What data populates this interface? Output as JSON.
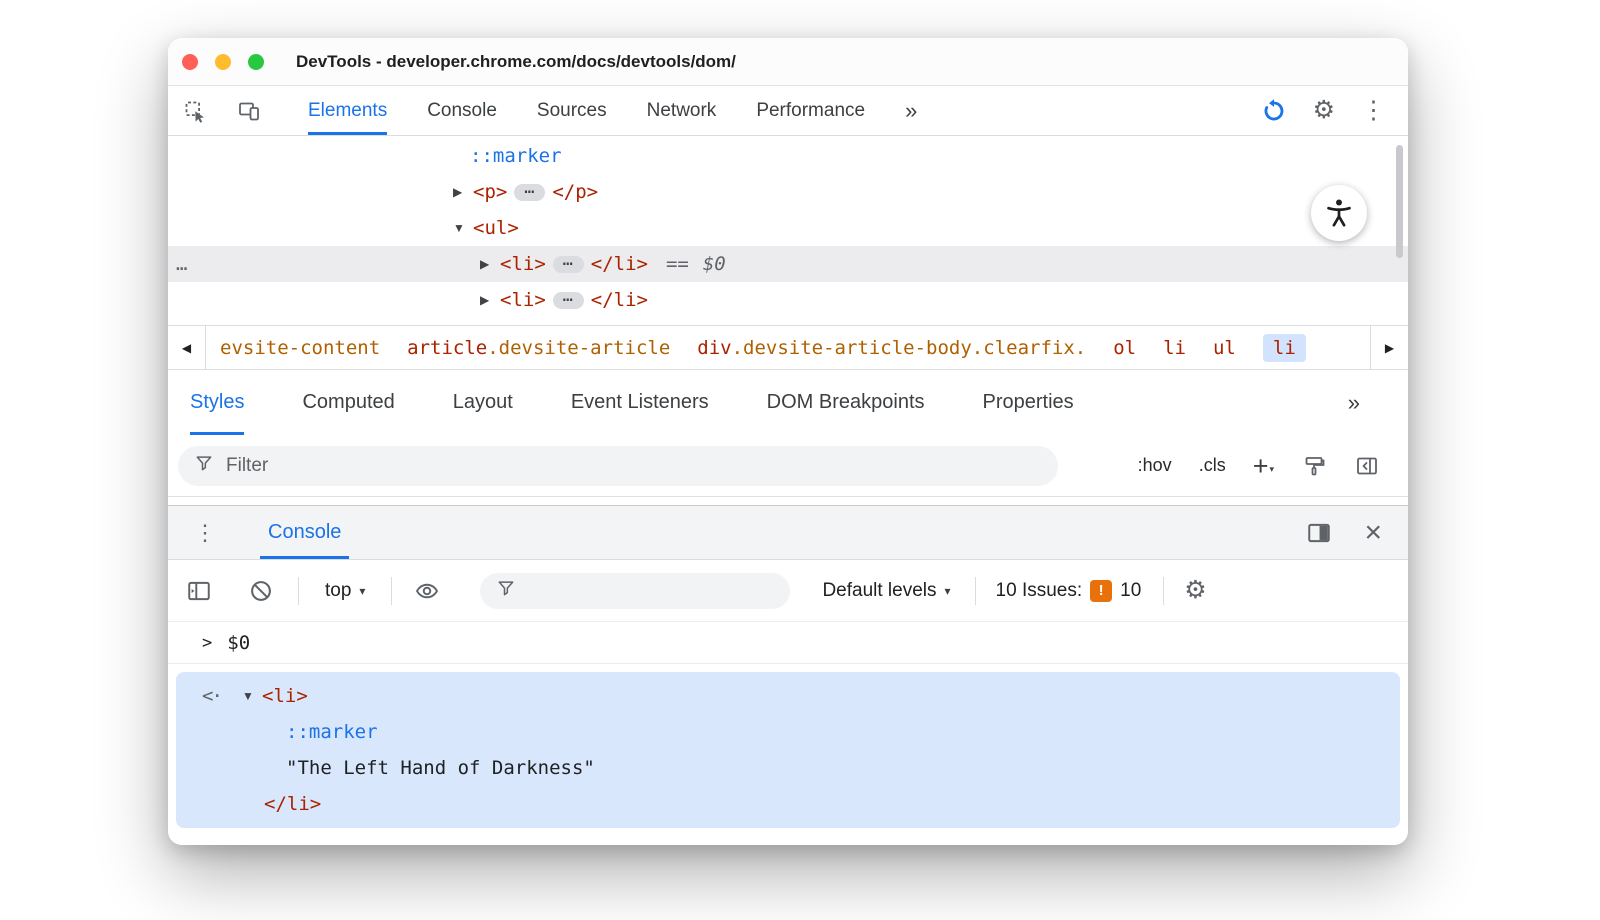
{
  "colors": {
    "accent_blue": "#1a73e8",
    "tag_maroon": "#aa2200",
    "class_orange": "#b06000",
    "pseudo_blue": "#1a73e8",
    "muted_gray": "#5f6368",
    "text_dark": "#202124",
    "selected_row_gray": "#ececee",
    "selected_crumb_blue": "#d3e3fd",
    "console_result_blue": "#d9e7fd",
    "issues_orange": "#e8710a",
    "traffic_red": "#ff5f57",
    "traffic_yellow": "#febc2e",
    "traffic_green": "#28c840"
  },
  "window": {
    "title": "DevTools - developer.chrome.com/docs/devtools/dom/"
  },
  "icons": {
    "collapsed_arrow": "▶",
    "expanded_arrow": "▼",
    "dropdown_caret": "▾",
    "kebab": "⋮",
    "gear": "⚙",
    "close": "×",
    "breadcrumb_back": "◀",
    "breadcrumb_forward": "▶",
    "overflow_chevrons": "»",
    "gutter_ellipsis": "…",
    "inline_ellipsis": "…",
    "output_marker": "<·",
    "prompt_chevron": ">",
    "issues_badge": "!"
  },
  "main_toolbar": {
    "tabs": [
      {
        "label": "Elements"
      },
      {
        "label": "Console"
      },
      {
        "label": "Sources"
      },
      {
        "label": "Network"
      },
      {
        "label": "Performance"
      }
    ]
  },
  "dom_tree": {
    "marker_pseudo": "::marker",
    "p_open": "<p>",
    "p_close": "</p>",
    "ul_open": "<ul>",
    "li_open": "<li>",
    "li_close": "</li>",
    "equals": "==",
    "dollar_zero": "$0"
  },
  "breadcrumbs": {
    "items": [
      {
        "text": "evsite-content"
      },
      {
        "tag": "article",
        "classes": ".devsite-article"
      },
      {
        "tag": "div",
        "classes": ".devsite-article-body.clearfix."
      },
      {
        "tag": "ol"
      },
      {
        "tag": "li"
      },
      {
        "tag": "ul"
      },
      {
        "tag": "li"
      }
    ]
  },
  "sidebar_tabs": {
    "tabs": [
      {
        "label": "Styles"
      },
      {
        "label": "Computed"
      },
      {
        "label": "Layout"
      },
      {
        "label": "Event Listeners"
      },
      {
        "label": "DOM Breakpoints"
      },
      {
        "label": "Properties"
      }
    ]
  },
  "styles_toolbar": {
    "filter_placeholder": "Filter",
    "hov_label": ":hov",
    "cls_label": ".cls",
    "plus_label": "+"
  },
  "console": {
    "tab_label": "Console",
    "context_label": "top",
    "default_levels_label": "Default levels",
    "issues_label": "10 Issues:",
    "issues_count": "10",
    "command": "$0",
    "result": {
      "li_open": "<li>",
      "marker": "::marker",
      "text_node": "\"The Left Hand of Darkness\"",
      "li_close": "</li>"
    }
  }
}
